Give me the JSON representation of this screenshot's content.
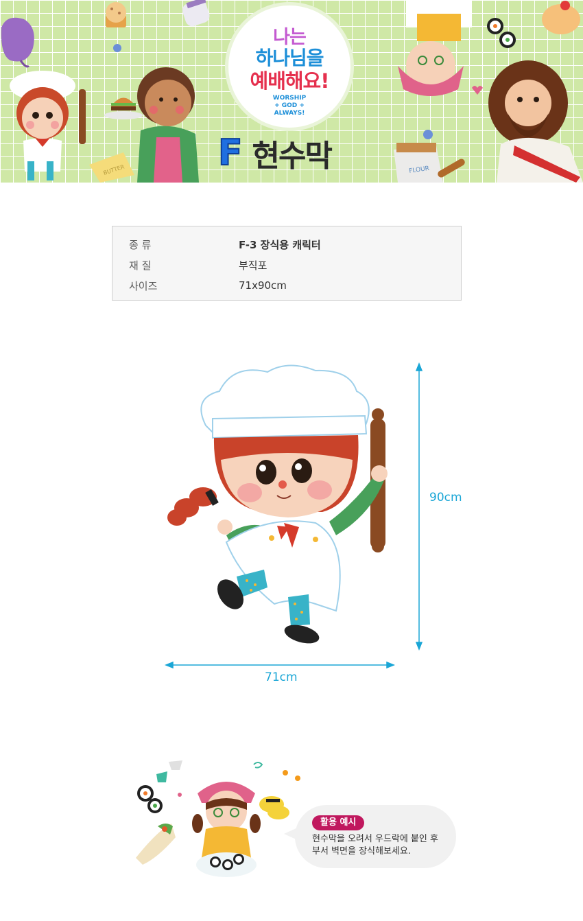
{
  "banner": {
    "logo_line1": "나는",
    "logo_line2": "하나님을",
    "logo_line3": "예배해요!",
    "logo_en_1": "WORSHIP",
    "logo_en_2": "+ GOD +",
    "logo_en_3": "ALWAYS!",
    "label_butter": "BUTTER",
    "label_flour": "FLOUR",
    "title_letter": "F",
    "title_word": "현수막"
  },
  "info": {
    "rows": [
      {
        "label": "종 류",
        "value": "F-3  장식용 캐릭터"
      },
      {
        "label": "재 질",
        "value": "부직포"
      },
      {
        "label": "사이즈",
        "value": "71x90cm"
      }
    ]
  },
  "dimensions": {
    "height": "90cm",
    "width": "71cm"
  },
  "usage": {
    "badge": "활용 예시",
    "text": "현수막을 오려서 우드락에 붙인 후 부서 벽면을 장식해보세요."
  },
  "colors": {
    "grid_green": "#cfe8a6",
    "dimension_blue": "#1aa6d6",
    "badge_magenta": "#c0185e"
  }
}
